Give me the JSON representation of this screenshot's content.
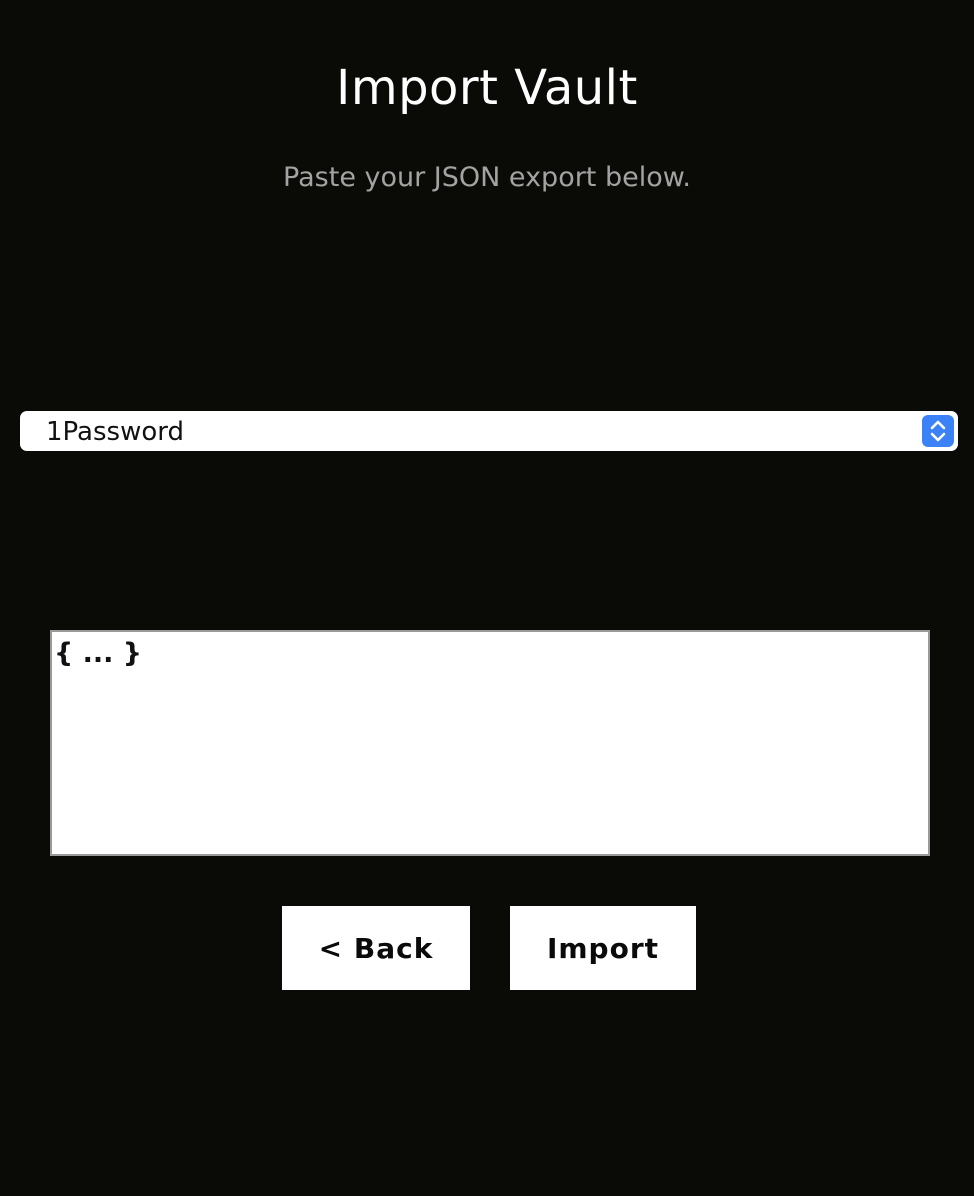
{
  "header": {
    "title": "Import Vault",
    "subtitle": "Paste your JSON export below."
  },
  "importer": {
    "source_selected": "1Password",
    "json_value": "{ ... }"
  },
  "actions": {
    "back_label": "< Back",
    "import_label": "Import"
  },
  "theme": {
    "background": "#0a0a06",
    "accent": "#3b82f6"
  },
  "icons": {
    "select_stepper": "chevron-up-down-icon"
  }
}
